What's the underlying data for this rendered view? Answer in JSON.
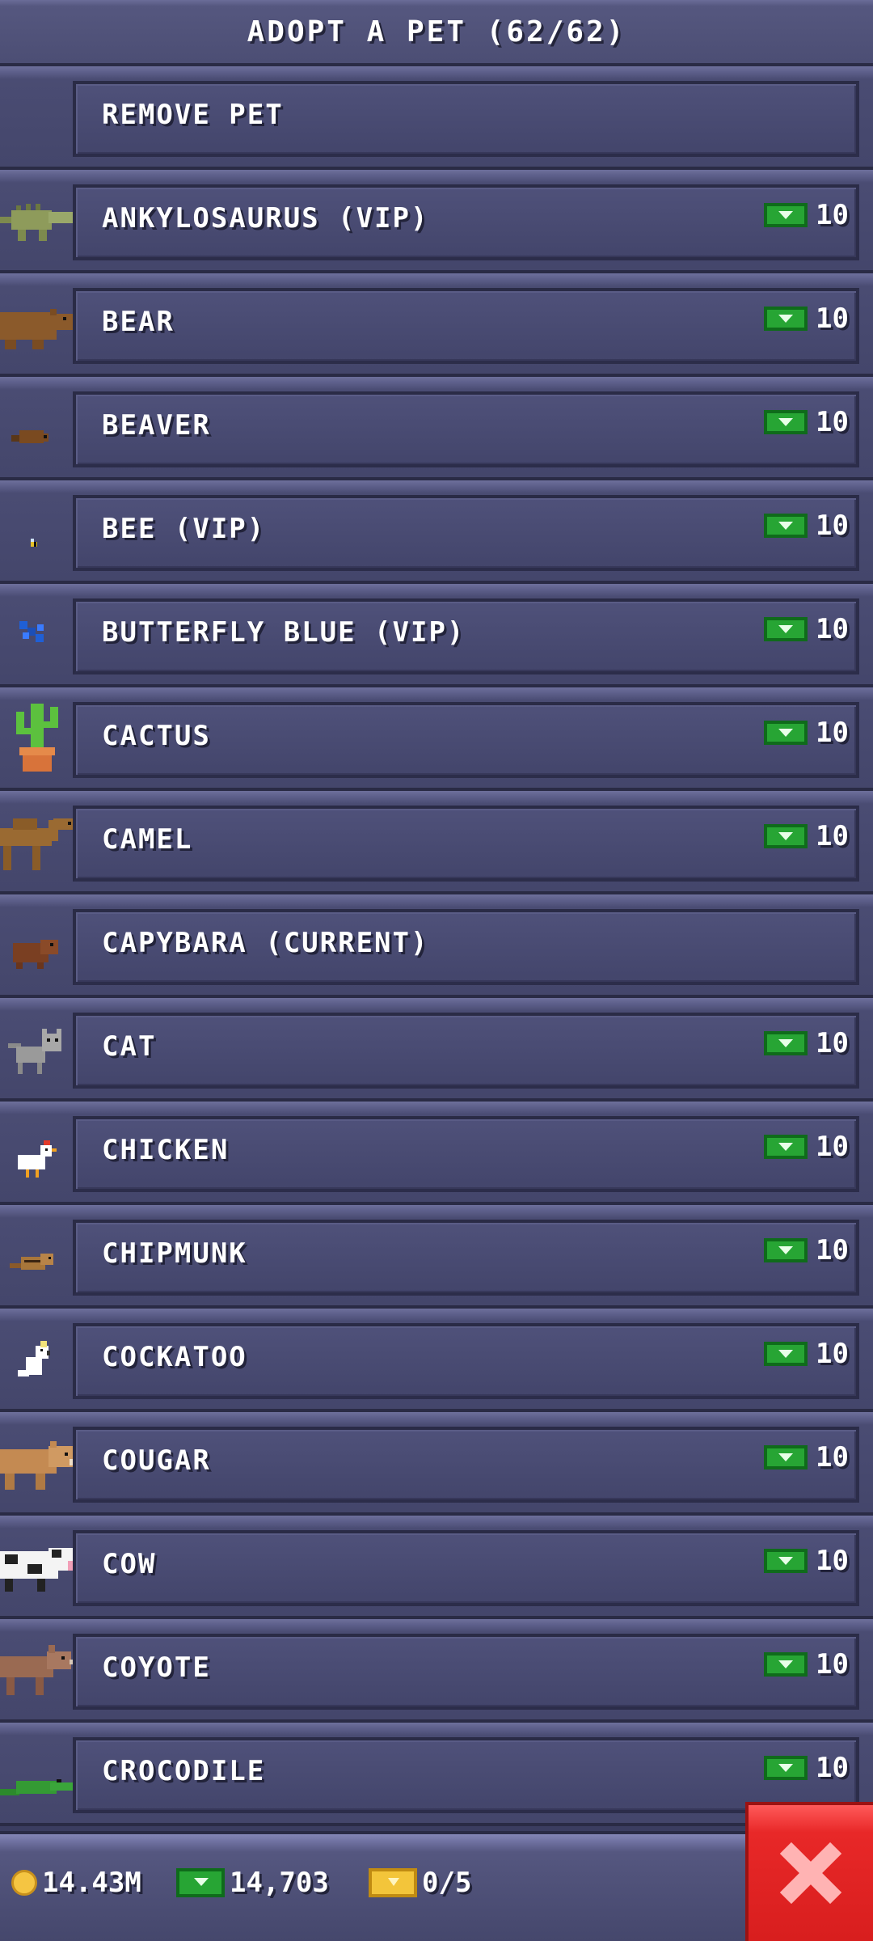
{
  "header": {
    "title": "ADOPT A PET (62/62)"
  },
  "remove_label": "REMOVE PET",
  "pets": [
    {
      "name": "ANKYLOSAURUS (VIP)",
      "price": "10",
      "icon": "ankylosaurus-icon"
    },
    {
      "name": "BEAR",
      "price": "10",
      "icon": "bear-icon"
    },
    {
      "name": "BEAVER",
      "price": "10",
      "icon": "beaver-icon"
    },
    {
      "name": "BEE (VIP)",
      "price": "10",
      "icon": "bee-icon"
    },
    {
      "name": "BUTTERFLY BLUE (VIP)",
      "price": "10",
      "icon": "butterfly-icon"
    },
    {
      "name": "CACTUS",
      "price": "10",
      "icon": "cactus-icon"
    },
    {
      "name": "CAMEL",
      "price": "10",
      "icon": "camel-icon"
    },
    {
      "name": "CAPYBARA (CURRENT)",
      "price": "",
      "icon": "capybara-icon"
    },
    {
      "name": "CAT",
      "price": "10",
      "icon": "cat-icon"
    },
    {
      "name": "CHICKEN",
      "price": "10",
      "icon": "chicken-icon"
    },
    {
      "name": "CHIPMUNK",
      "price": "10",
      "icon": "chipmunk-icon"
    },
    {
      "name": "COCKATOO",
      "price": "10",
      "icon": "cockatoo-icon"
    },
    {
      "name": "COUGAR",
      "price": "10",
      "icon": "cougar-icon"
    },
    {
      "name": "COW",
      "price": "10",
      "icon": "cow-icon"
    },
    {
      "name": "COYOTE",
      "price": "10",
      "icon": "coyote-icon"
    },
    {
      "name": "CROCODILE",
      "price": "10",
      "icon": "crocodile-icon"
    }
  ],
  "footer": {
    "coins": "14.43M",
    "bux": "14,703",
    "tickets": "0/5"
  },
  "colors": {
    "accent": "#27a534",
    "close": "#e82828",
    "panel": "#44466b"
  }
}
